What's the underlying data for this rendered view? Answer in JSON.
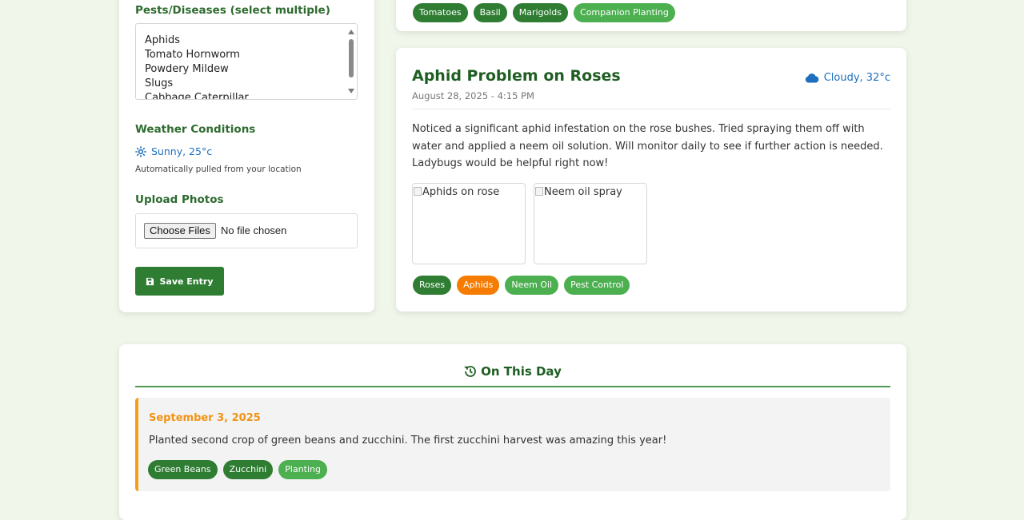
{
  "colors": {
    "background": "#f1f6ea",
    "primary_green": "#2e7d32",
    "light_green": "#4caf50",
    "orange": "#f57c00",
    "weather_blue": "#1e6fbf",
    "memory_accent": "#f59d1a"
  },
  "form": {
    "pests_label": "Pests/Diseases (select multiple)",
    "pests_options": [
      "Aphids",
      "Tomato Hornworm",
      "Powdery Mildew",
      "Slugs",
      "Cabbage Caterpillar"
    ],
    "weather_label": "Weather Conditions",
    "weather_icon": "sun-icon",
    "weather_value": "Sunny, 25°c",
    "weather_help": "Automatically pulled from your location",
    "upload_label": "Upload Photos",
    "file_button": "Choose Files",
    "file_status": "No file chosen",
    "save_icon": "save-icon",
    "save_label": "Save Entry"
  },
  "entries": [
    {
      "tags": [
        {
          "label": "Tomatoes",
          "color": "#2e7d32"
        },
        {
          "label": "Basil",
          "color": "#2e7d32"
        },
        {
          "label": "Marigolds",
          "color": "#2e7d32"
        },
        {
          "label": "Companion Planting",
          "color": "#4caf50"
        }
      ]
    },
    {
      "title": "Aphid Problem on Roses",
      "date": "August 28, 2025 - 4:15 PM",
      "weather_icon": "cloud-icon",
      "weather": "Cloudy, 32°c",
      "body": "Noticed a significant aphid infestation on the rose bushes. Tried spraying them off with water and applied a neem oil solution. Will monitor daily to see if further action is needed. Ladybugs would be helpful right now!",
      "photos": [
        "Aphids on rose",
        "Neem oil spray"
      ],
      "tags": [
        {
          "label": "Roses",
          "color": "#2e7d32"
        },
        {
          "label": "Aphids",
          "color": "#f57c00"
        },
        {
          "label": "Neem Oil",
          "color": "#4caf50"
        },
        {
          "label": "Pest Control",
          "color": "#4caf50"
        }
      ]
    }
  ],
  "on_this_day": {
    "icon": "history-icon",
    "title": "On This Day",
    "memory": {
      "date": "September 3, 2025",
      "text": "Planted second crop of green beans and zucchini. The first zucchini harvest was amazing this year!",
      "tags": [
        {
          "label": "Green Beans",
          "color": "#2e7d32"
        },
        {
          "label": "Zucchini",
          "color": "#2e7d32"
        },
        {
          "label": "Planting",
          "color": "#4caf50"
        }
      ]
    }
  }
}
